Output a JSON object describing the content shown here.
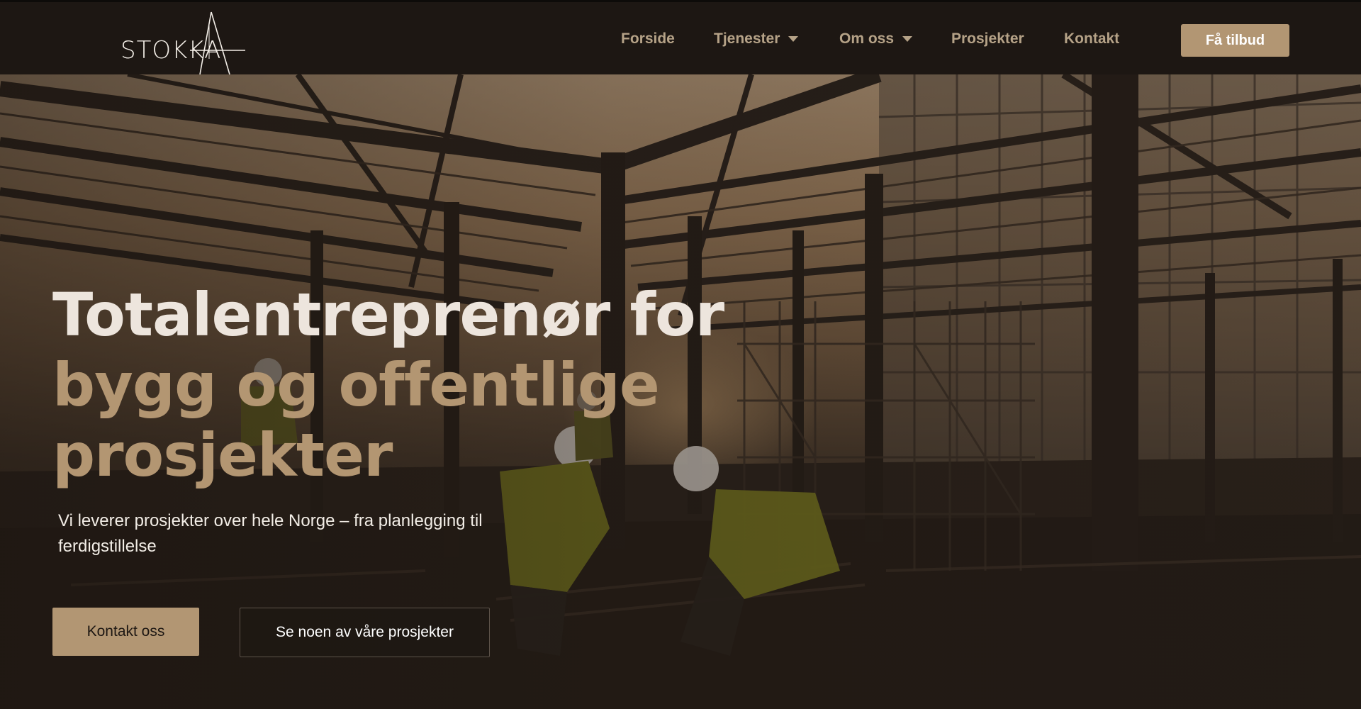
{
  "brand": {
    "logo_text": "STOKKA",
    "logo_icon": "stylized-a-mark-icon"
  },
  "nav": {
    "items": [
      {
        "label": "Forside",
        "has_dropdown": false
      },
      {
        "label": "Tjenester",
        "has_dropdown": true
      },
      {
        "label": "Om oss",
        "has_dropdown": true
      },
      {
        "label": "Prosjekter",
        "has_dropdown": false
      },
      {
        "label": "Kontakt",
        "has_dropdown": false
      }
    ],
    "cta_label": "Få tilbud"
  },
  "hero": {
    "headline_line1": "Totalentreprenør for",
    "headline_line2": "bygg og offentlige",
    "headline_line3": "prosjekter",
    "subtitle": "Vi leverer prosjekter over hele Norge – fra planlegging til ferdigstillelse",
    "primary_button": "Kontakt oss",
    "secondary_button": "Se noen av våre prosjekter",
    "background_image": "construction-site-steel-frame-with-workers"
  },
  "colors": {
    "header_bg": "#1d1713",
    "accent": "#b29673",
    "nav_text": "#b5a287",
    "headline_light": "#ede5dd",
    "headline_accent": "#b39672"
  }
}
